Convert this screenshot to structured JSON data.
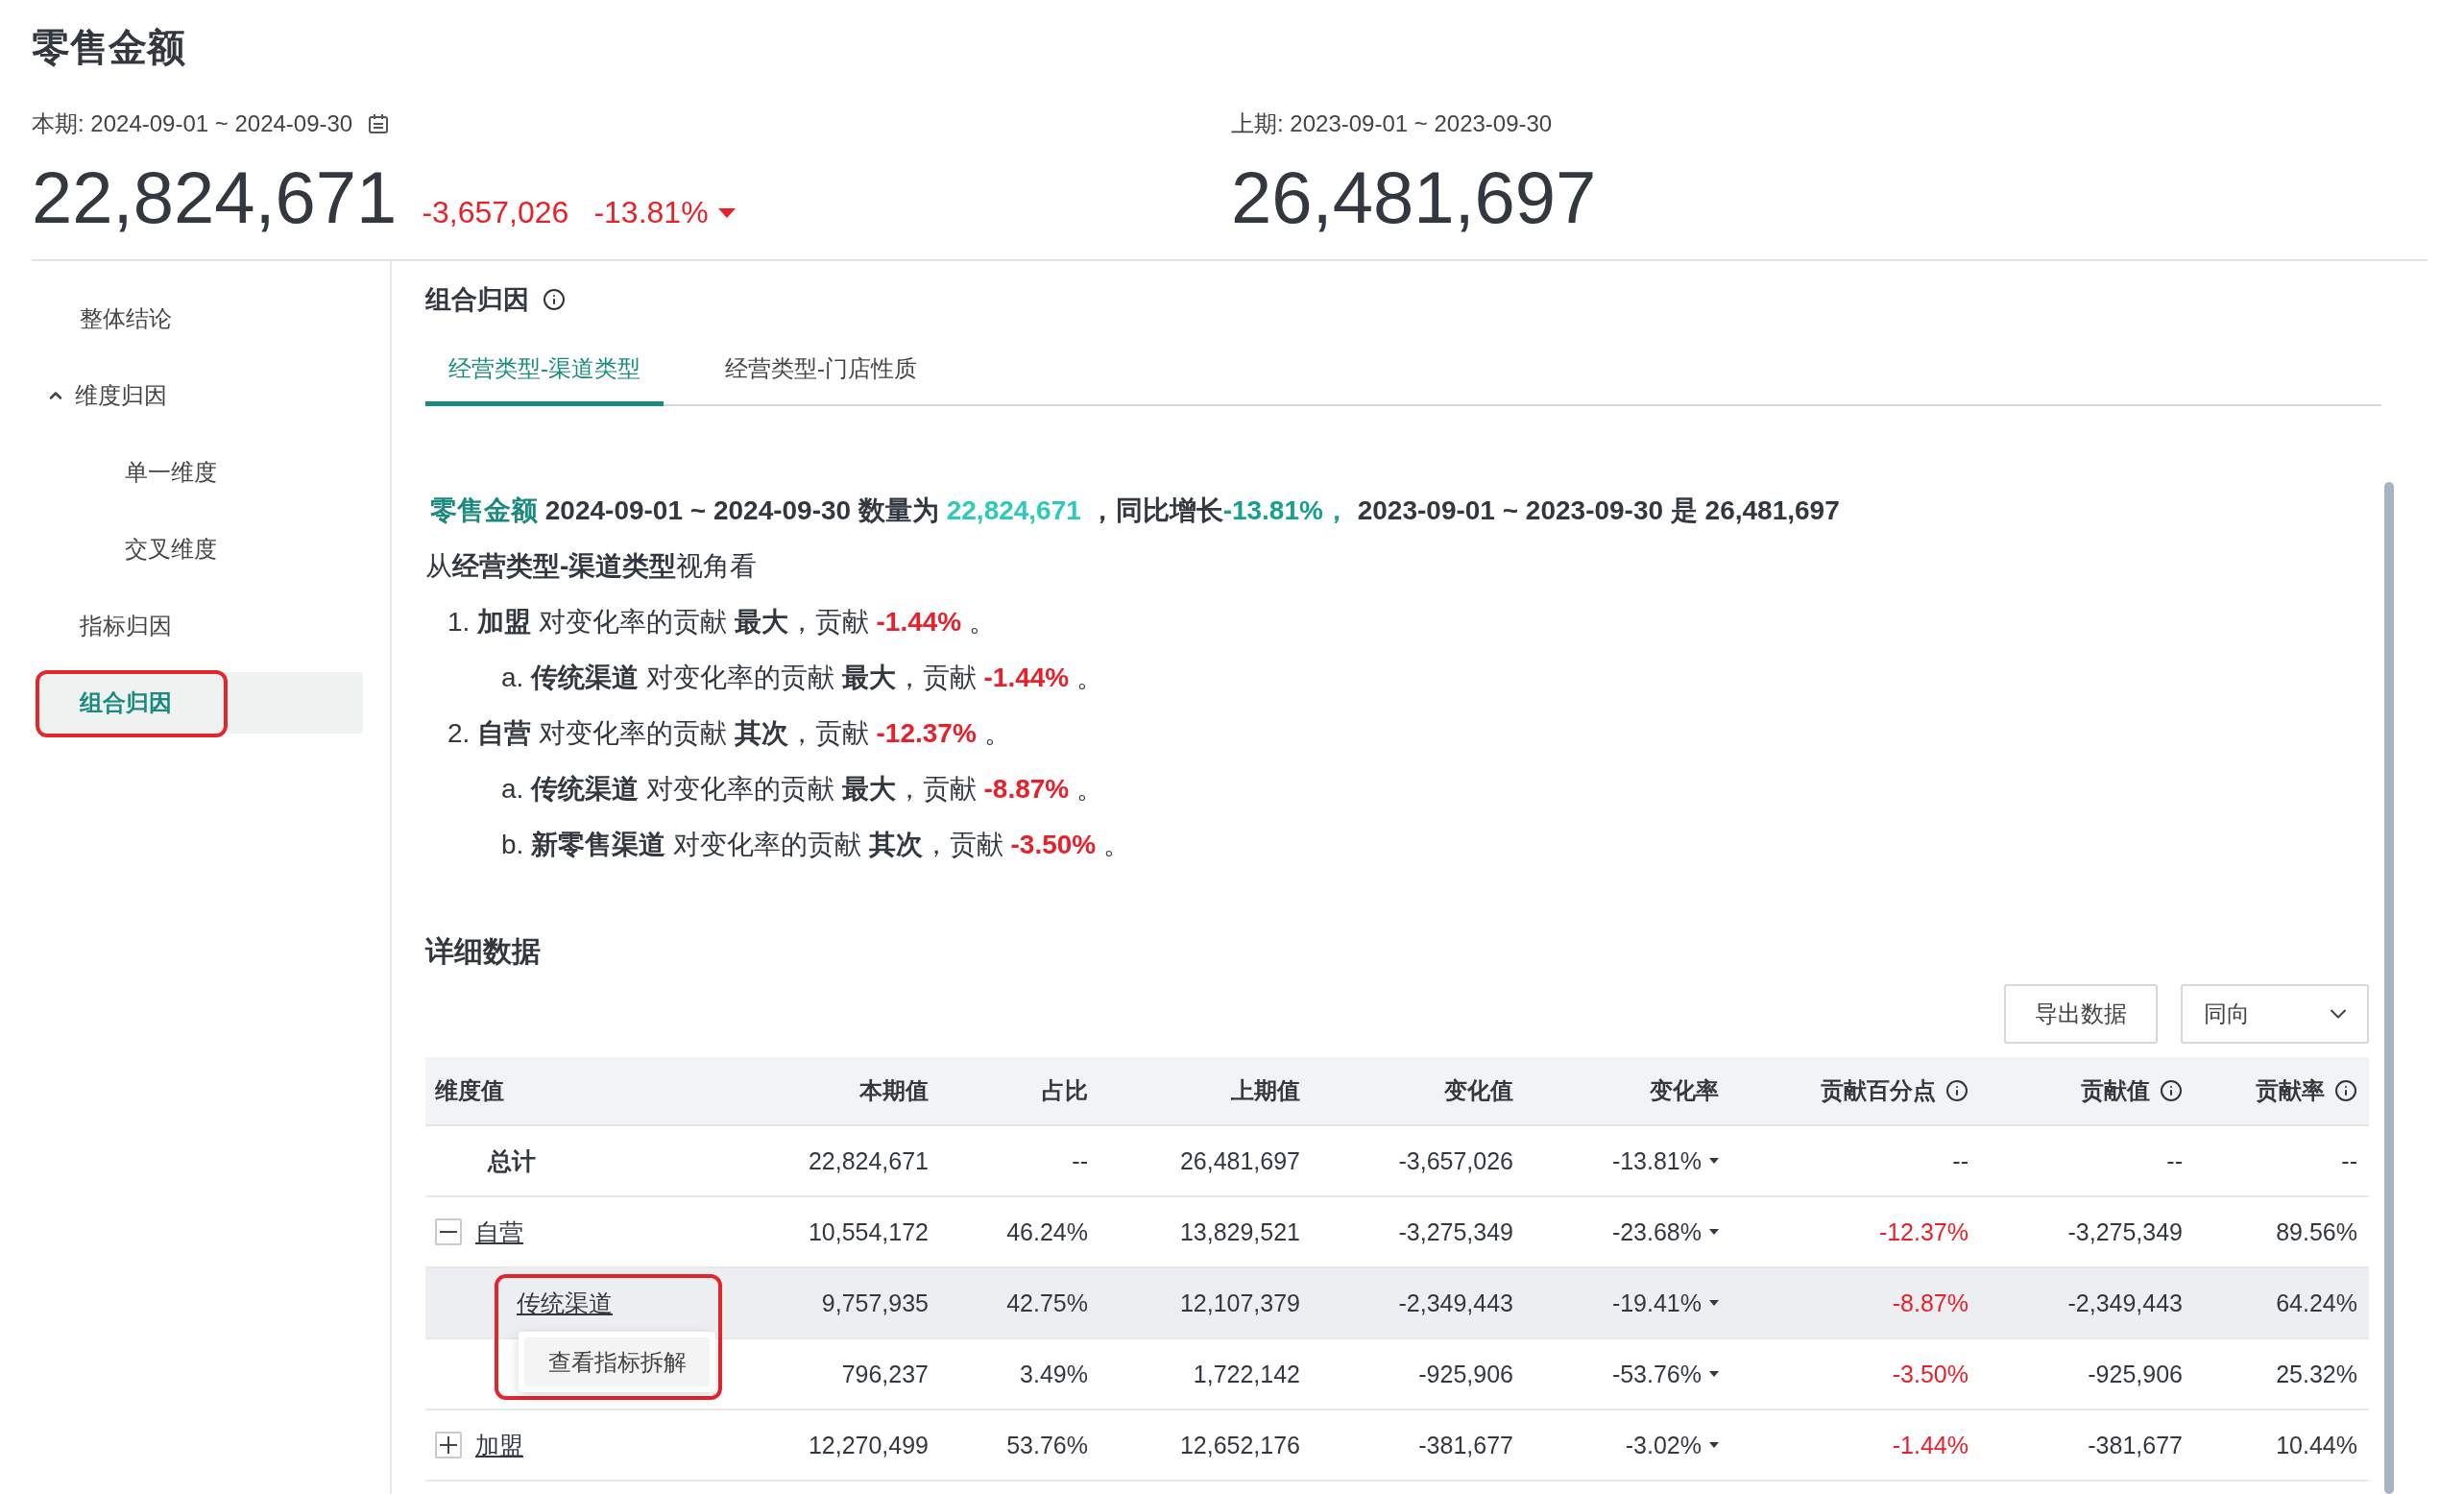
{
  "title": "零售金额",
  "current": {
    "label": "本期: 2024-09-01 ~ 2024-09-30",
    "value": "22,824,671",
    "change": "-3,657,026",
    "rate": "-13.81%",
    "decreased": true
  },
  "previous": {
    "label": "上期: 2023-09-01 ~ 2023-09-30",
    "value": "26,481,697"
  },
  "sidebar": {
    "items": [
      {
        "label": "整体结论",
        "selected": false
      },
      {
        "label": "维度归因",
        "selected": false,
        "expanded": true,
        "children": [
          {
            "label": "单一维度",
            "selected": false
          },
          {
            "label": "交叉维度",
            "selected": false
          }
        ]
      },
      {
        "label": "指标归因",
        "selected": false
      },
      {
        "label": "组合归因",
        "selected": true,
        "annotated": true
      }
    ]
  },
  "section": {
    "title": "组合归因"
  },
  "tabs": [
    {
      "label": "经营类型-渠道类型",
      "selected": true
    },
    {
      "label": "经营类型-门店性质",
      "selected": false
    }
  ],
  "summary": {
    "lead": [
      {
        "kind": "metric",
        "text": "零售金额"
      },
      {
        "kind": "bold",
        "text": " 2024-09-01 ~ 2024-09-30 "
      },
      {
        "kind": "bold",
        "text": "数量为 "
      },
      {
        "kind": "value",
        "text": "22,824,671"
      },
      {
        "kind": "bold",
        "text": " ，同比增长"
      },
      {
        "kind": "growth",
        "text": "-13.81%，"
      },
      {
        "kind": "bold",
        "text": "  2023-09-01 ~ 2023-09-30 是 26,481,697"
      }
    ],
    "perspective": [
      {
        "kind": "plain",
        "text": "从"
      },
      {
        "kind": "bold",
        "text": "经营类型-渠道类型"
      },
      {
        "kind": "plain",
        "text": "视角看"
      }
    ],
    "items": [
      {
        "marker": "1.",
        "segments": [
          {
            "kind": "bold",
            "text": "加盟"
          },
          {
            "kind": "plain",
            "text": " 对变化率的贡献 "
          },
          {
            "kind": "bold",
            "text": "最大"
          },
          {
            "kind": "plain",
            "text": "，贡献 "
          },
          {
            "kind": "negative",
            "text": "-1.44%"
          },
          {
            "kind": "plain",
            "text": " 。"
          }
        ],
        "children": [
          {
            "marker": "a.",
            "segments": [
              {
                "kind": "bold",
                "text": "传统渠道"
              },
              {
                "kind": "plain",
                "text": " 对变化率的贡献 "
              },
              {
                "kind": "bold",
                "text": "最大"
              },
              {
                "kind": "plain",
                "text": "，贡献 "
              },
              {
                "kind": "negative",
                "text": "-1.44%"
              },
              {
                "kind": "plain",
                "text": " 。"
              }
            ]
          }
        ]
      },
      {
        "marker": "2.",
        "segments": [
          {
            "kind": "bold",
            "text": "自营"
          },
          {
            "kind": "plain",
            "text": " 对变化率的贡献 "
          },
          {
            "kind": "bold",
            "text": "其次"
          },
          {
            "kind": "plain",
            "text": "，贡献 "
          },
          {
            "kind": "negative",
            "text": "-12.37%"
          },
          {
            "kind": "plain",
            "text": " 。"
          }
        ],
        "children": [
          {
            "marker": "a.",
            "segments": [
              {
                "kind": "bold",
                "text": "传统渠道"
              },
              {
                "kind": "plain",
                "text": " 对变化率的贡献 "
              },
              {
                "kind": "bold",
                "text": "最大"
              },
              {
                "kind": "plain",
                "text": "，贡献 "
              },
              {
                "kind": "negative",
                "text": "-8.87%"
              },
              {
                "kind": "plain",
                "text": " 。"
              }
            ]
          },
          {
            "marker": "b.",
            "segments": [
              {
                "kind": "bold",
                "text": "新零售渠道"
              },
              {
                "kind": "plain",
                "text": " 对变化率的贡献 "
              },
              {
                "kind": "bold",
                "text": "其次"
              },
              {
                "kind": "plain",
                "text": "，贡献 "
              },
              {
                "kind": "negative",
                "text": "-3.50%"
              },
              {
                "kind": "plain",
                "text": " 。"
              }
            ]
          }
        ]
      }
    ]
  },
  "detail": {
    "title": "详细数据",
    "export_button": "导出数据",
    "mode_select": {
      "value": "同向"
    }
  },
  "table": {
    "columns": [
      {
        "label": "维度值"
      },
      {
        "label": "本期值"
      },
      {
        "label": "占比"
      },
      {
        "label": "上期值"
      },
      {
        "label": "变化值"
      },
      {
        "label": "变化率"
      },
      {
        "label": "贡献百分点",
        "info": true
      },
      {
        "label": "贡献值",
        "info": true
      },
      {
        "label": "贡献率",
        "info": true
      }
    ],
    "rows": [
      {
        "kind": "total",
        "cells": [
          "总计",
          "22,824,671",
          "--",
          "26,481,697",
          "-3,657,026",
          {
            "text": "-13.81%",
            "decreased": true
          },
          "--",
          "--",
          "--"
        ]
      },
      {
        "kind": "group",
        "expanded": true,
        "cells": [
          "自营",
          "10,554,172",
          "46.24%",
          "13,829,521",
          "-3,275,349",
          {
            "text": "-23.68%",
            "decreased": true
          },
          {
            "text": "-12.37%",
            "negative": true
          },
          "-3,275,349",
          "89.56%"
        ]
      },
      {
        "kind": "child",
        "hovered": true,
        "menu": {
          "items": [
            "查看指标拆解"
          ],
          "annotated": true
        },
        "cells": [
          "传统渠道",
          "9,757,935",
          "42.75%",
          "12,107,379",
          "-2,349,443",
          {
            "text": "-19.41%",
            "decreased": true
          },
          {
            "text": "-8.87%",
            "negative": true
          },
          "-2,349,443",
          "64.24%"
        ]
      },
      {
        "kind": "child",
        "hovered": false,
        "cells": [
          "",
          "796,237",
          "3.49%",
          "1,722,142",
          "-925,906",
          {
            "text": "-53.76%",
            "decreased": true
          },
          {
            "text": "-3.50%",
            "negative": true
          },
          "-925,906",
          "25.32%"
        ]
      },
      {
        "kind": "group",
        "expanded": false,
        "cells": [
          "加盟",
          "12,270,499",
          "53.76%",
          "12,652,176",
          "-381,677",
          {
            "text": "-3.02%",
            "decreased": true
          },
          {
            "text": "-1.44%",
            "negative": true
          },
          "-381,677",
          "10.44%"
        ]
      }
    ]
  }
}
